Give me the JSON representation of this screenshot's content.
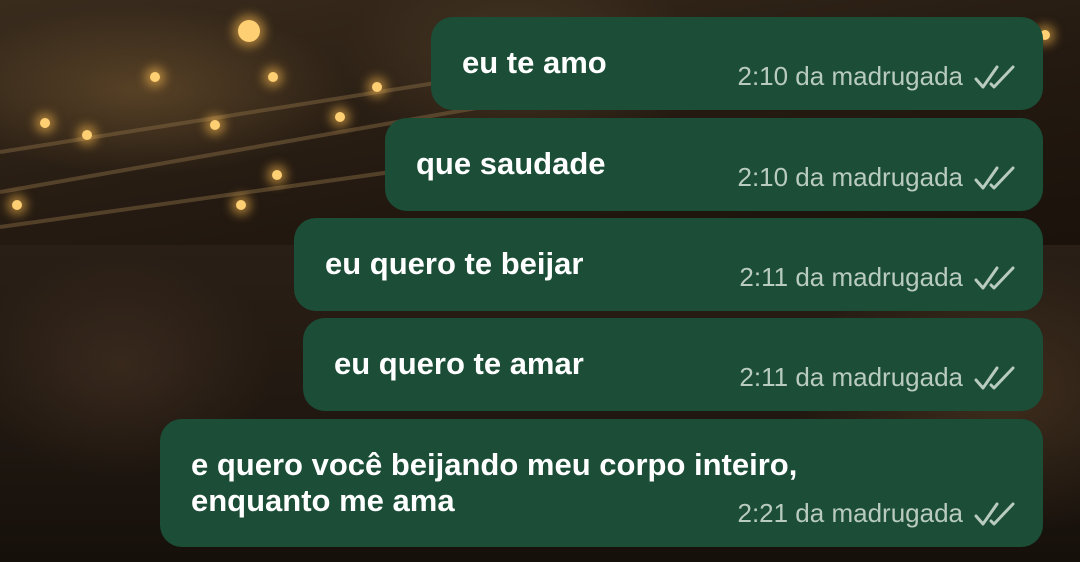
{
  "background": {
    "description_colors": {
      "bubble": "#1b4d37",
      "text": "#ffffff",
      "meta": "#b9cbbf"
    }
  },
  "messages": [
    {
      "text": "eu te amo",
      "time": "2:10 da madrugada",
      "status_icon": "double-check-icon"
    },
    {
      "text": "que saudade",
      "time": "2:10 da madrugada",
      "status_icon": "double-check-icon"
    },
    {
      "text": "eu quero te beijar",
      "time": "2:11 da madrugada",
      "status_icon": "double-check-icon"
    },
    {
      "text": "eu quero te amar",
      "time": "2:11 da madrugada",
      "status_icon": "double-check-icon"
    },
    {
      "text_lines": [
        "e quero você beijando meu corpo inteiro,",
        "enquanto me ama"
      ],
      "time": "2:21 da madrugada",
      "status_icon": "double-check-icon"
    }
  ]
}
